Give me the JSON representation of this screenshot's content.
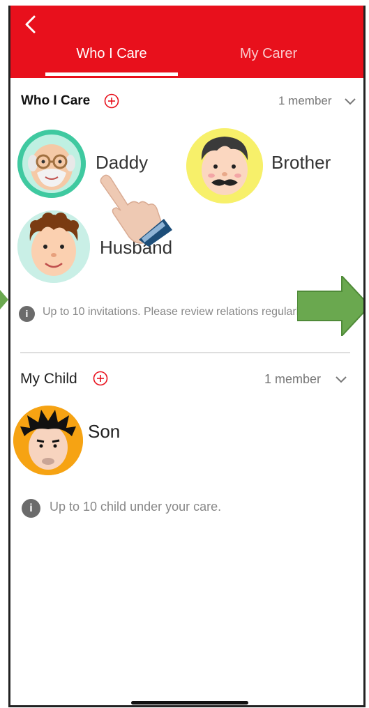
{
  "tabs": [
    {
      "label": "Who I Care",
      "active": true
    },
    {
      "label": "My Carer",
      "active": false
    }
  ],
  "who_i_care": {
    "title": "Who I Care",
    "member_count": "1 member",
    "people": [
      {
        "name": "Daddy",
        "avatar": "grandpa-glasses-icon"
      },
      {
        "name": "Brother",
        "avatar": "mustache-man-icon"
      },
      {
        "name": "Husband",
        "avatar": "curly-hair-man-icon"
      }
    ],
    "info": "Up to 10 invitations. Please review relations regularly."
  },
  "my_child": {
    "title": "My Child",
    "member_count": "1 member",
    "people": [
      {
        "name": "Son",
        "avatar": "spiky-hair-boy-icon"
      }
    ],
    "info": "Up to 10 child under your care."
  },
  "colors": {
    "header_red": "#e8101c",
    "add_icon_red": "#e8101c",
    "arrow_green": "#6aa84f"
  }
}
